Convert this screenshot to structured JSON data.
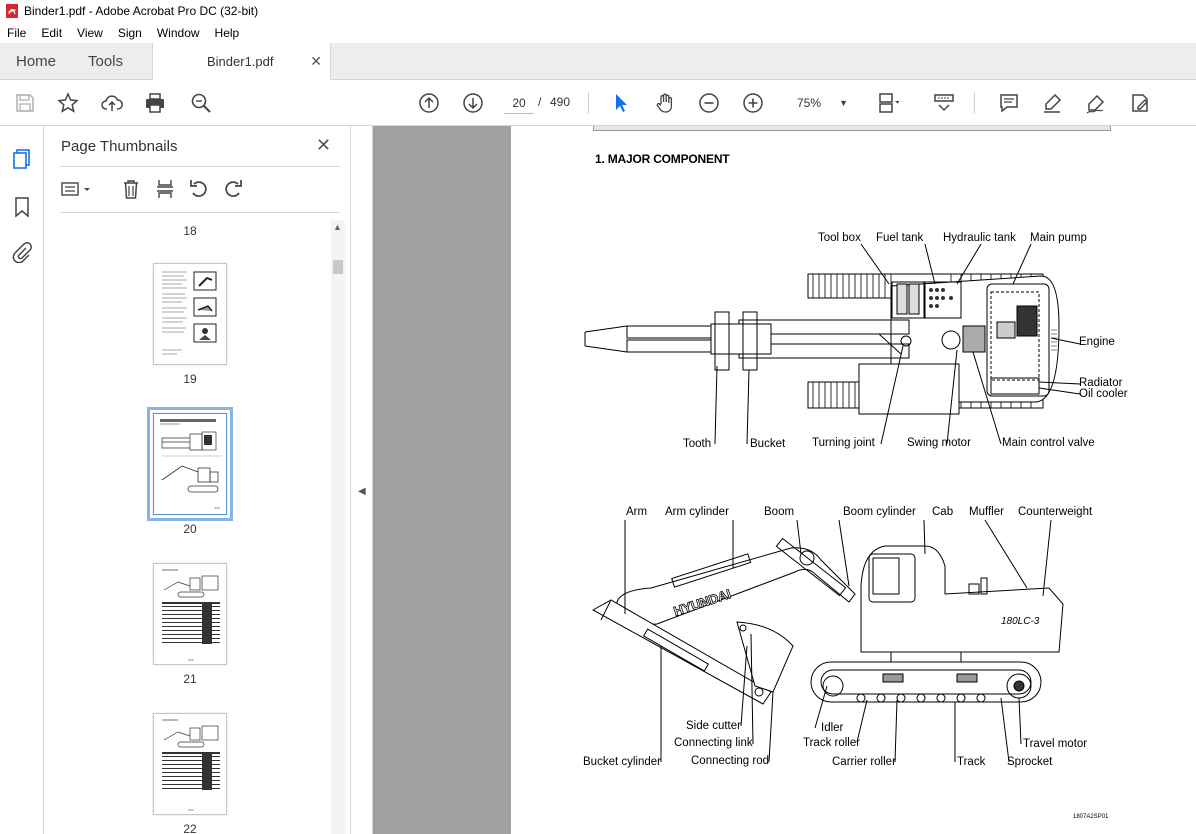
{
  "window": {
    "title": "Binder1.pdf - Adobe Acrobat Pro DC (32-bit)"
  },
  "menu": [
    "File",
    "Edit",
    "View",
    "Sign",
    "Window",
    "Help"
  ],
  "tabs": {
    "home": "Home",
    "tools": "Tools",
    "document": "Binder1.pdf"
  },
  "toolbar": {
    "current_page": "20",
    "page_separator": "/",
    "total_pages": "490",
    "zoom": "75%",
    "icons": [
      "save-icon",
      "bookmark-star-icon",
      "upload-icon",
      "print-icon",
      "find-icon",
      "prev-page-icon",
      "next-page-icon",
      "select-cursor-icon",
      "hand-icon",
      "zoom-out-icon",
      "zoom-in-icon",
      "fit-page-icon",
      "scroll-mode-icon",
      "comment-icon",
      "highlight-icon",
      "sign-icon",
      "edit-pdf-icon"
    ]
  },
  "panel": {
    "title": "Page Thumbnails",
    "pages": [
      "18",
      "19",
      "20",
      "21",
      "22"
    ],
    "selected_page": "20"
  },
  "document": {
    "section_title": "1.  MAJOR COMPONENT",
    "figure_id": "1807A2SP01",
    "top_view_labels": {
      "tool_box": "Tool box",
      "fuel_tank": "Fuel tank",
      "hydraulic_tank": "Hydraulic tank",
      "main_pump": "Main pump",
      "engine": "Engine",
      "radiator": "Radiator",
      "oil_cooler": "Oil cooler",
      "tooth": "Tooth",
      "bucket": "Bucket",
      "turning_joint": "Turning joint",
      "swing_motor": "Swing motor",
      "main_control_valve": "Main control valve"
    },
    "side_view_labels": {
      "arm": "Arm",
      "arm_cylinder": "Arm cylinder",
      "boom": "Boom",
      "boom_cylinder": "Boom cylinder",
      "cab": "Cab",
      "muffler": "Muffler",
      "counterweight": "Counterweight",
      "side_cutter": "Side cutter",
      "connecting_link": "Connecting link",
      "bucket_cylinder": "Bucket cylinder",
      "connecting_rod": "Connecting rod",
      "idler": "Idler",
      "track_roller": "Track roller",
      "carrier_roller": "Carrier roller",
      "track": "Track",
      "sprocket": "Sprocket",
      "travel_motor": "Travel motor"
    },
    "brand_text": "HYUNDAI",
    "model_text": "180LC-3"
  },
  "colors": {
    "accent": "#1473e6",
    "selected_thumb": "#8ab4e8",
    "doc_background": "#a0a0a0"
  }
}
